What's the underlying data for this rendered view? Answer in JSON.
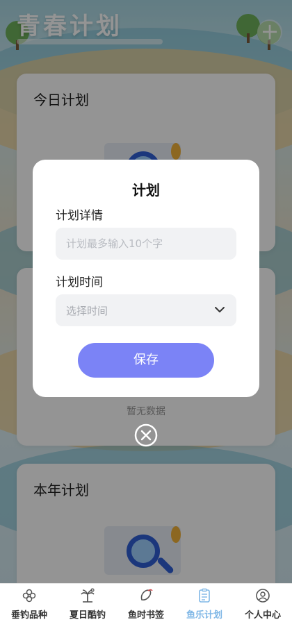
{
  "header": {
    "title": "青春计划"
  },
  "cards": {
    "today_title": "今日计划",
    "empty_text": "暂无数据",
    "year_title": "本年计划"
  },
  "modal": {
    "title": "计划",
    "detail_label": "计划详情",
    "detail_placeholder": "计划最多输入10个字",
    "detail_value": "",
    "time_label": "计划时间",
    "time_placeholder": "选择时间",
    "save_label": "保存"
  },
  "tabbar": {
    "items": [
      {
        "label": "垂钓品种",
        "icon": "flower-icon"
      },
      {
        "label": "夏日酷钓",
        "icon": "palm-tree-icon"
      },
      {
        "label": "鱼时书签",
        "icon": "bookmark-icon"
      },
      {
        "label": "鱼乐计划",
        "icon": "clipboard-icon",
        "active": true
      },
      {
        "label": "个人中心",
        "icon": "user-icon"
      }
    ],
    "active_color": "#7fb7e6"
  },
  "colors": {
    "accent": "#7b83f6",
    "overlay": "rgba(0,0,0,0.42)"
  }
}
